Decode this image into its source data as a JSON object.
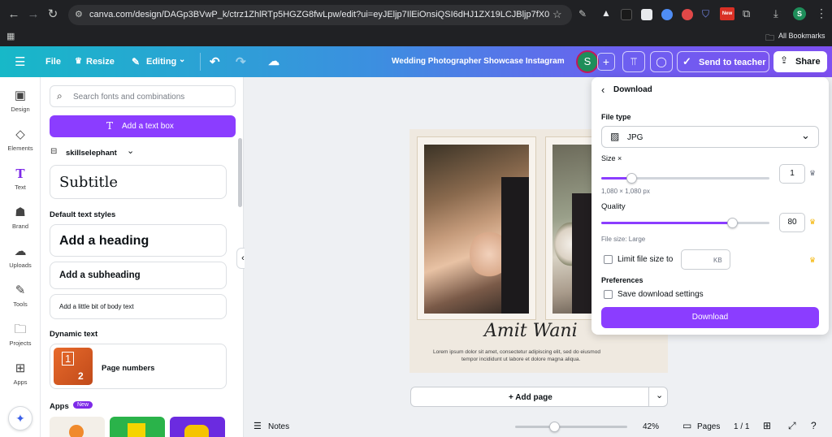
{
  "browser": {
    "url": "canva.com/design/DAGp3BVwP_k/ctrz1ZhlRTp5HGZG8fwLpw/edit?ui=eyJEljp7IlEiOnsiQSI6dHJ1ZX19LCJBljp7fX0",
    "bookmarks_label": "All Bookmarks",
    "profile_initial": "S",
    "new_badge": "New"
  },
  "topbar": {
    "file": "File",
    "resize": "Resize",
    "editing": "Editing",
    "design_title": "Wedding Photographer Showcase Instagram",
    "avatar_initial": "S",
    "send_to_teacher": "Send to teacher",
    "share": "Share"
  },
  "rail": {
    "items": [
      {
        "label": "Design",
        "icon": "design-icon"
      },
      {
        "label": "Elements",
        "icon": "elements-icon"
      },
      {
        "label": "Text",
        "icon": "text-icon"
      },
      {
        "label": "Brand",
        "icon": "brand-icon"
      },
      {
        "label": "Uploads",
        "icon": "uploads-icon"
      },
      {
        "label": "Tools",
        "icon": "tools-icon"
      },
      {
        "label": "Projects",
        "icon": "projects-icon"
      },
      {
        "label": "Apps",
        "icon": "apps-icon"
      }
    ]
  },
  "panel": {
    "search_placeholder": "Search fonts and combinations",
    "add_text_box": "Add a text box",
    "brand_kit": "skillselephant",
    "subtitle_sample": "Subtitle",
    "default_styles_heading": "Default text styles",
    "heading": "Add a heading",
    "subheading": "Add a subheading",
    "body": "Add a little bit of body text",
    "dynamic_text_heading": "Dynamic text",
    "page_numbers": "Page numbers",
    "page_numbers_thumb_1": "1",
    "page_numbers_thumb_2": "2",
    "apps_heading": "Apps",
    "apps_badge": "New"
  },
  "canvas": {
    "signature": "Amit Wani",
    "lorem_line1": "Lorem ipsum dolor sit amet, consectetur adipiscing elit, sed do eiusmod",
    "lorem_line2": "tempor incididunt ut labore et dolore magna aliqua.",
    "add_page": "+ Add page"
  },
  "download": {
    "title": "Download",
    "file_type_label": "File type",
    "file_type_value": "JPG",
    "size_label": "Size ×",
    "size_value": "1",
    "size_fraction": 0.18,
    "size_px": "1,080 × 1,080 px",
    "quality_label": "Quality",
    "quality_value": "80",
    "quality_fraction": 0.78,
    "file_size": "File size: Large",
    "limit_file_size": "Limit file size to",
    "kb_unit": "KB",
    "preferences_label": "Preferences",
    "save_settings": "Save download settings",
    "download_button": "Download"
  },
  "bottombar": {
    "notes": "Notes",
    "zoom": "42%",
    "zoom_fraction": 0.35,
    "pages": "Pages",
    "page_count": "1 / 1"
  },
  "colors": {
    "accent": "#8b3dff",
    "topbar_start": "#17b8c8",
    "topbar_end": "#7d4ff0",
    "crown": "#f5b400"
  }
}
